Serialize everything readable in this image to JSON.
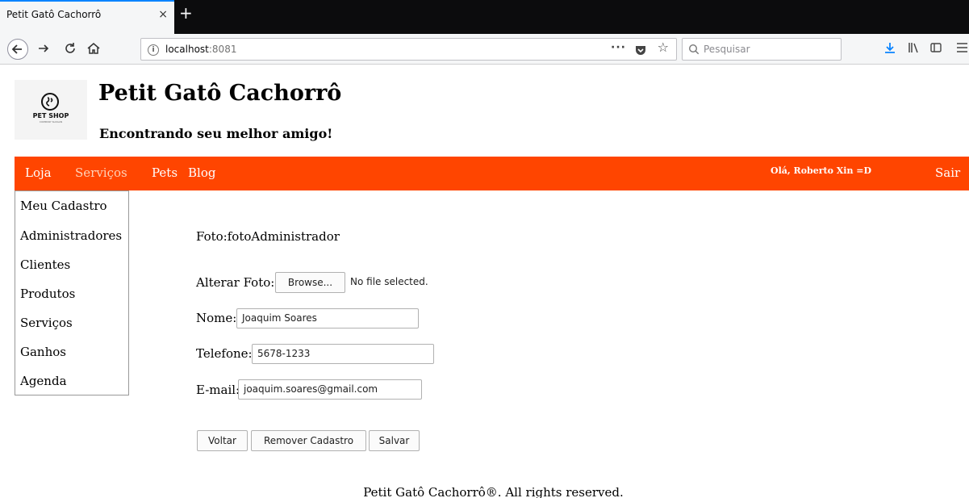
{
  "browser": {
    "tab_title": "Petit Gatô Cachorrô",
    "tab_close_glyph": "×",
    "new_tab_glyph": "+",
    "url_host": "localhost",
    "url_port": ":8081",
    "page_actions_glyph": "···",
    "search_placeholder": "Pesquisar"
  },
  "header": {
    "logo_text": "PET SHOP",
    "logo_subtext": "COMPANY SLOGAN",
    "title": "Petit Gatô Cachorrô",
    "tagline": "Encontrando seu melhor amigo!"
  },
  "menu": {
    "items": [
      {
        "label": "Loja"
      },
      {
        "label": "Serviços"
      },
      {
        "label": "Pets"
      },
      {
        "label": "Blog"
      }
    ],
    "greeting": "Olá, Roberto Xin =D",
    "logout": "Sair",
    "accent_color": "#ff4500"
  },
  "dropdown": {
    "items": [
      {
        "label": "Meu Cadastro"
      },
      {
        "label": "Administradores"
      },
      {
        "label": "Clientes"
      },
      {
        "label": "Produtos"
      },
      {
        "label": "Serviços"
      },
      {
        "label": "Ganhos"
      },
      {
        "label": "Agenda"
      }
    ]
  },
  "form": {
    "photo_text": "Foto:fotoAdministrador",
    "change_photo_label": "Alterar Foto:",
    "browse_label": "Browse...",
    "no_file_text": "No file selected.",
    "name_label": "Nome:",
    "name_value": "Joaquim Soares",
    "phone_label": "Telefone:",
    "phone_value": "5678-1233",
    "email_label": "E-mail:",
    "email_value": "joaquim.soares@gmail.com",
    "back_label": "Voltar",
    "remove_label": "Remover Cadastro",
    "save_label": "Salvar"
  },
  "footer": {
    "text": "Petit Gatô Cachorrô®. All rights reserved."
  }
}
